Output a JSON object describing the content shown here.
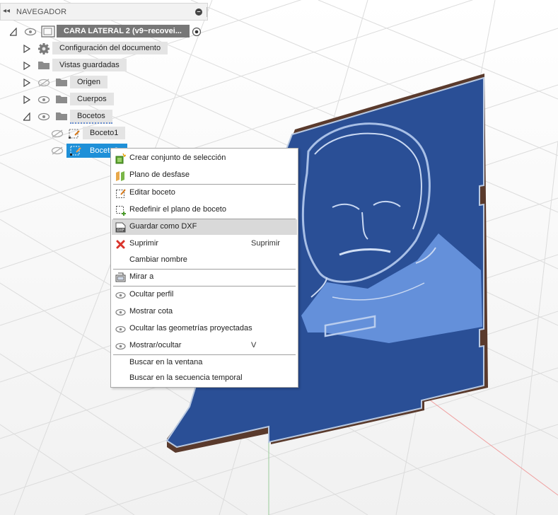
{
  "navigator": {
    "title": "NAVEGADOR",
    "collapse_icon": "double-chevron-left-icon",
    "minimize_icon": "minus-circle-icon",
    "root": {
      "label": "CARA LATERAL 2 (v9~recovei...",
      "icon": "component-icon"
    },
    "items": [
      {
        "label": "Configuración del documento",
        "icon": "gear-icon"
      },
      {
        "label": "Vistas guardadas",
        "icon": "folder-icon"
      },
      {
        "label": "Origen",
        "icon": "folder-icon"
      },
      {
        "label": "Cuerpos",
        "icon": "folder-icon"
      },
      {
        "label": "Bocetos",
        "icon": "folder-icon"
      },
      {
        "label": "Boceto1",
        "icon": "sketch-icon"
      },
      {
        "label": "Boceto2",
        "icon": "sketch-icon",
        "selected": true
      }
    ]
  },
  "context_menu": {
    "items": [
      {
        "label": "Crear conjunto de selección",
        "icon": "selection-set-icon"
      },
      {
        "label": "Plano de desfase",
        "icon": "offset-plane-icon"
      },
      {
        "label": "Editar boceto",
        "icon": "edit-sketch-icon"
      },
      {
        "label": "Redefinir el plano de boceto",
        "icon": "redefine-plane-icon"
      },
      {
        "label": "Guardar como DXF",
        "icon": "dxf-icon",
        "highlighted": true
      },
      {
        "label": "Suprimir",
        "icon": "delete-x-icon",
        "shortcut": "Suprimir"
      },
      {
        "label": "Cambiar nombre",
        "icon": ""
      },
      {
        "label": "Mirar a",
        "icon": "look-at-icon"
      },
      {
        "label": "Ocultar perfil",
        "icon": "eye-icon"
      },
      {
        "label": "Mostrar cota",
        "icon": "eye-icon"
      },
      {
        "label": "Ocultar las geometrías proyectadas",
        "icon": "eye-icon"
      },
      {
        "label": "Mostrar/ocultar",
        "icon": "eye-icon",
        "shortcut": "V"
      },
      {
        "label": "Buscar en la ventana",
        "icon": ""
      },
      {
        "label": "Buscar en la secuencia temporal",
        "icon": ""
      }
    ]
  },
  "colors": {
    "selection": "#1e90d8",
    "panel_fill": "#2a4f96",
    "panel_engrave": "#8fb2e6",
    "panel_edge": "#5a3a2c",
    "menu_highlight": "#d9d9d9",
    "delete_red": "#d9342b"
  }
}
